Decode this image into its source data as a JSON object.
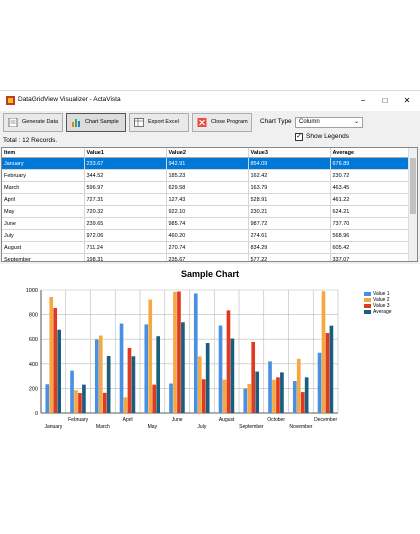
{
  "window": {
    "title": "DataGridView Visualizer - ActaVista",
    "minimize": "−",
    "maximize": "□",
    "close": "✕"
  },
  "toolbar": {
    "generate": "Generate Data",
    "chart_sample": "Chart Sample",
    "export": "Export Excel",
    "close": "Close Program",
    "chart_type_label": "Chart Type",
    "chart_type_value": "Column",
    "show_legends_label": "Show Legends",
    "show_legends_checked": "✓",
    "total": "Total : 12 Records."
  },
  "grid": {
    "columns": [
      "Item",
      "Value1",
      "Value2",
      "Value3",
      "Average"
    ],
    "rows": [
      [
        "January",
        "233.67",
        "942.91",
        "854.09",
        "676.89"
      ],
      [
        "February",
        "344.52",
        "185.23",
        "162.42",
        "230.72"
      ],
      [
        "March",
        "596.97",
        "629.58",
        "163.79",
        "463.45"
      ],
      [
        "April",
        "727.31",
        "127.43",
        "528.91",
        "461.22"
      ],
      [
        "May",
        "720.32",
        "922.10",
        "230.21",
        "624.21"
      ],
      [
        "June",
        "239.65",
        "985.74",
        "987.72",
        "737.70"
      ],
      [
        "July",
        "972.06",
        "460.20",
        "274.61",
        "568.96"
      ],
      [
        "August",
        "711.24",
        "270.74",
        "834.29",
        "605.42"
      ],
      [
        "September",
        "198.31",
        "235.67",
        "577.22",
        "337.07"
      ]
    ]
  },
  "chart_data": {
    "type": "bar",
    "title": "Sample Chart",
    "categories": [
      "January",
      "February",
      "March",
      "April",
      "May",
      "June",
      "July",
      "August",
      "September",
      "October",
      "November",
      "December"
    ],
    "series": [
      {
        "name": "Value 1",
        "color": "#4a90e2",
        "values": [
          233.67,
          344.52,
          596.97,
          727.31,
          720.32,
          239.65,
          972.06,
          711.24,
          198.31,
          420,
          260,
          490
        ]
      },
      {
        "name": "Value 2",
        "color": "#f5a742",
        "values": [
          942.91,
          185.23,
          629.58,
          127.43,
          922.1,
          985.74,
          460.2,
          270.74,
          235.67,
          270,
          440,
          990
        ]
      },
      {
        "name": "Value 3",
        "color": "#e0391f",
        "values": [
          854.09,
          162.42,
          163.79,
          528.91,
          230.21,
          987.72,
          274.61,
          834.29,
          577.22,
          290,
          170,
          650
        ]
      },
      {
        "name": "Average",
        "color": "#1a5e7e",
        "values": [
          676.89,
          230.72,
          463.45,
          461.22,
          624.21,
          737.7,
          568.96,
          605.42,
          337.07,
          330,
          290,
          710
        ]
      }
    ],
    "ylim": [
      0,
      1000
    ],
    "yticks": [
      "0",
      "200",
      "400",
      "600",
      "800",
      "1000"
    ],
    "grid": true,
    "legend_position": "right"
  }
}
